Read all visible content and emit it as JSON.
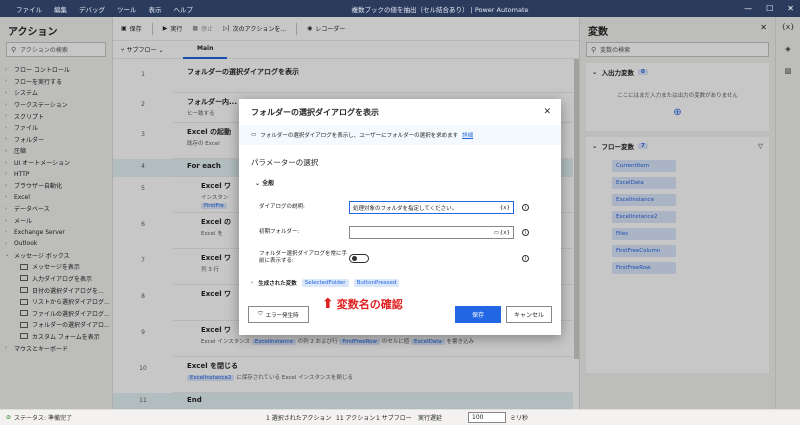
{
  "titlebar": {
    "menu": [
      "ファイル",
      "編集",
      "デバッグ",
      "ツール",
      "表示",
      "ヘルプ"
    ],
    "title": "複数ブックの値を抽出（セル結合あり） | Power Automate",
    "min": "—",
    "max": "☐",
    "close": "✕"
  },
  "left": {
    "title": "アクション",
    "search_placeholder": "アクションの検索",
    "items": [
      "フロー コントロール",
      "フローを実行する",
      "システム",
      "ワークステーション",
      "スクリプト",
      "ファイル",
      "フォルダー",
      "圧縮",
      "UI オートメーション",
      "HTTP",
      "ブラウザー自動化",
      "Excel",
      "データベース",
      "メール",
      "Exchange Server",
      "Outlook",
      "メッセージ ボックス"
    ],
    "sub_items": [
      "メッセージを表示",
      "入力ダイアログを表示",
      "日付の選択ダイアログを...",
      "リストから選択ダイアログ...",
      "ファイルの選択ダイアログ...",
      "フォルダーの選択ダイアロ...",
      "カスタム フォームを表示"
    ],
    "last_item": "マウスとキーボード"
  },
  "toolbar": {
    "save": "保存",
    "run": "実行",
    "stop": "停止",
    "next": "次のアクションを...",
    "recorder": "レコーダー"
  },
  "tabs": {
    "subflow": "サブフロー",
    "main": "Main"
  },
  "steps": [
    {
      "num": "1",
      "title": "フォルダーの選択ダイアログを表示",
      "desc": ""
    },
    {
      "num": "2",
      "title": "フォルダー内...",
      "desc": "ヒ一致する"
    },
    {
      "num": "3",
      "title": "Excel の起動",
      "desc": "既存の Excel"
    },
    {
      "num": "4",
      "title": "For each",
      "desc": ""
    },
    {
      "num": "5",
      "title": "Excel ワ",
      "desc": "インスタン"
    },
    {
      "num": "6",
      "title": "Excel の",
      "desc": "Excel を"
    },
    {
      "num": "7",
      "title": "Excel ワ",
      "desc": "列 3 行"
    },
    {
      "num": "8",
      "title": "Excel ワ",
      "desc": ""
    },
    {
      "num": "9",
      "title": "Excel ワ",
      "desc": "Excel インスタンス"
    },
    {
      "num": "10",
      "title": "Excel を閉じる",
      "desc": "に保存されている Excel インスタンスを閉じる"
    },
    {
      "num": "11",
      "title": "End",
      "desc": ""
    }
  ],
  "step_chips": {
    "firstfree": "FirstFre",
    "step9": [
      "ExcelInstance",
      "FirstFreeRow",
      "ExcelData"
    ],
    "step9_text": [
      "の列 2 および行",
      "のセルに値",
      "を書き込み"
    ],
    "step10": "ExcelInstance2"
  },
  "right": {
    "title": "変数",
    "search_placeholder": "変数の検索",
    "io_title": "入出力変数",
    "io_count": "0",
    "io_empty": "ここにはまだ入力または出力の変数がありません",
    "flow_title": "フロー変数",
    "flow_count": "7",
    "flow_vars": [
      "CurrentItem",
      "ExcelData",
      "ExcelInstance",
      "ExcelInstance2",
      "Files",
      "FirstFreeColumn",
      "FirstFreeRow"
    ]
  },
  "status": {
    "state": "ステータス: 準備完了",
    "selected": "1 選択されたアクション",
    "actions": "11 アクション",
    "subflow": "1 サブフロー",
    "delay_label": "実行遅延",
    "delay_value": "100",
    "unit": "ミリ秒"
  },
  "dialog": {
    "title": "フォルダーの選択ダイアログを表示",
    "info": "フォルダーの選択ダイアログを表示し、ユーザーにフォルダーの選択を求めます",
    "info_link": "詳細",
    "params_title": "パラメーターの選択",
    "group": "全般",
    "f1_label": "ダイアログの説明:",
    "f1_value": "処理対象のフォルダを指定してください。",
    "f2_label": "初期フォルダー:",
    "f3_label": "フォルダー選択ダイアログを常に手前に表示する:",
    "gen_label": "生成された変数",
    "gen_vars": [
      "SelectedFolder",
      "ButtonPressed"
    ],
    "btn_error": "エラー発生時",
    "btn_save": "保存",
    "btn_cancel": "キャンセル",
    "fx": "{x}"
  },
  "annotation": "変数名の確認",
  "colors": {
    "accent": "#2266e3",
    "annotation": "#e02020",
    "title_bar": "#2a3b5e"
  }
}
